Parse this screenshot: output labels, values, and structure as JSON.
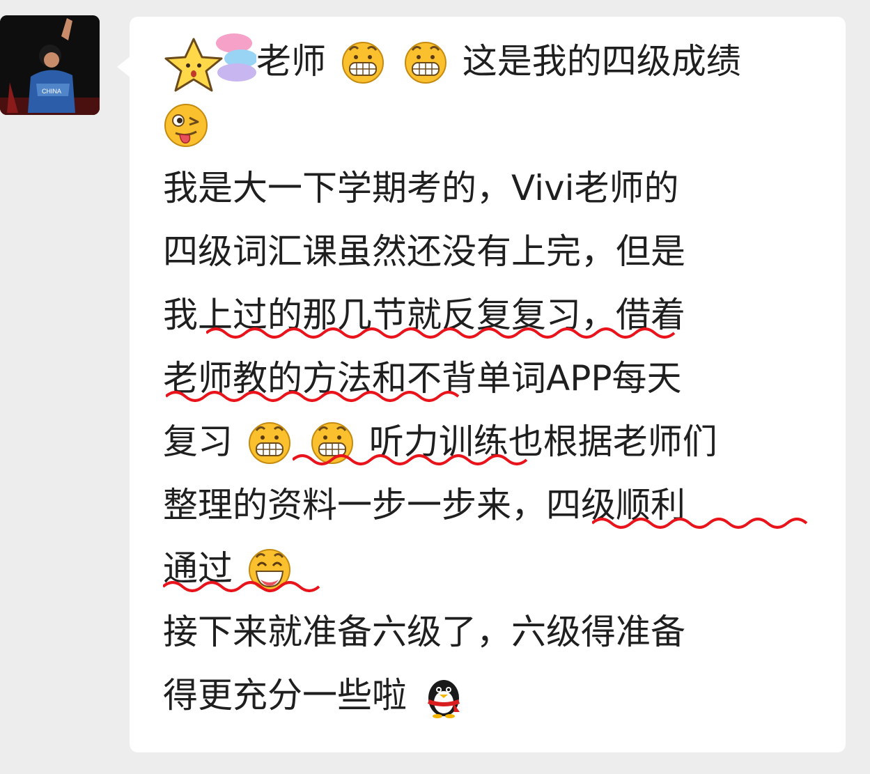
{
  "chat": {
    "message": {
      "line1": {
        "text": "老师",
        "text2": "这是我的四级成绩"
      },
      "line3": "我是大一下学期考的，Vivi老师的",
      "line4": "四级词汇课虽然还没有上完，但是",
      "line5": "我上过的那几节就反复复习，借着",
      "line6": "老师教的方法和不背单词APP每天",
      "line7": {
        "a": "复习",
        "b": "听力训练也根据老师们"
      },
      "line8": "整理的资料一步一步来，四级顺利",
      "line9": "通过",
      "line10": "接下来就准备六级了，六级得准备",
      "line11": "得更充分一些啦"
    }
  },
  "icons": {
    "avatar": "user-avatar-photo",
    "sticker": "star-rainbow-sticker",
    "grin": "grinning-emoji",
    "wink": "wink-tongue-emoji",
    "smile": "big-smile-emoji",
    "penguin": "qq-penguin-emoji"
  },
  "colors": {
    "background": "#ededed",
    "bubble": "#ffffff",
    "text": "#1f1f1f",
    "underline": "#e8131b"
  }
}
